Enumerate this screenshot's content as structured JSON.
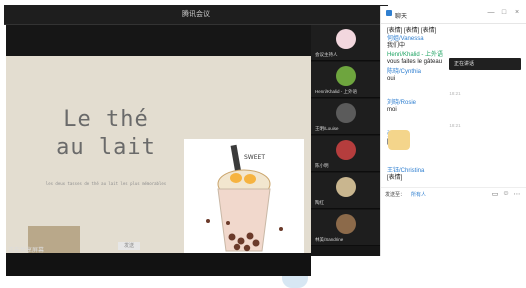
{
  "window": {
    "title": "腾讯会议",
    "minimize": "—",
    "maximize": "□",
    "close": "×"
  },
  "slide": {
    "title_line1": "Le thé",
    "title_line2": "au lait",
    "subtitle": "les deux tasses de thé au lait\nles plus mémorables",
    "illustration_label": "SWEET"
  },
  "share_indicator": "正在共享屏幕",
  "tiles": [
    {
      "name": "会议主持人",
      "color": "#f2d7de"
    },
    {
      "name": "Henri/Khalid - 上外语",
      "color": "#6ea53e"
    },
    {
      "name": "王明/Louise",
      "color": "#5b5b5b"
    },
    {
      "name": "陈小明",
      "color": "#b53d3d"
    },
    {
      "name": "陶红",
      "color": "#c9b68f"
    },
    {
      "name": "林美/Sandrine",
      "color": "#8c6a4a"
    }
  ],
  "chat": {
    "header": "聊天",
    "messages": [
      {
        "sender": "",
        "text": "[表情] [表情] [表情]"
      },
      {
        "sender": "何姐/Vanessa",
        "text": "我们中"
      },
      {
        "sender": "Henri/Khalid - 上外语",
        "text": "vous faites le gâteau"
      },
      {
        "sender": "陈晓/Cynthia",
        "text": "oui"
      },
      {
        "sender": "",
        "time": "18:21"
      },
      {
        "sender": "刘晓/Rosie",
        "text": "moi"
      },
      {
        "sender": "",
        "time": "18:21"
      },
      {
        "sender": "张小明",
        "text": "[表情]"
      },
      {
        "sender": "王钰/Christina",
        "text": "[表情]"
      }
    ],
    "popup": "正在讲话",
    "send_to_label": "发送至：",
    "send_to_value": "所有人",
    "send_button": "发送"
  }
}
